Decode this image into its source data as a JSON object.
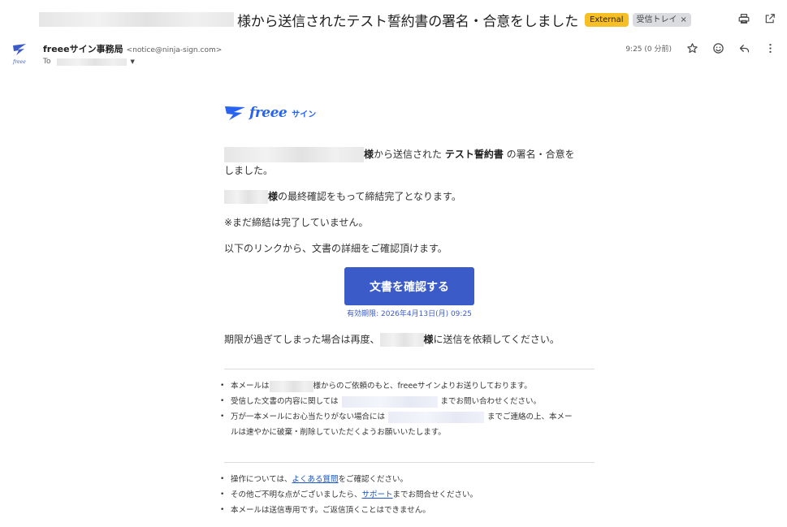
{
  "subject": {
    "text": "様から送信されたテスト誓約書の署名・合意をしました",
    "chips": {
      "external": "External",
      "inbox": "受信トレイ",
      "inbox_close": "×"
    }
  },
  "top_icons": [
    "print-icon",
    "open-in-new-window-icon"
  ],
  "sender": {
    "name": "freeeサイン事務局",
    "email": "<notice@ninja-sign.com>",
    "to_label": "To",
    "time": "9:25 (0 分前)"
  },
  "email_body": {
    "logo": {
      "brand": "freee",
      "product": "サイン"
    },
    "para1": {
      "suffix_sama": "様",
      "text_a": "から送信された ",
      "doc_name": "テスト誓約書",
      "text_b": " の署名・合意を",
      "text_c": "しました。"
    },
    "para2": {
      "sama": "様",
      "text": "の最終確認をもって締結完了となります。"
    },
    "para3": "※まだ締結は完了していません。",
    "para4": "以下のリンクから、文書の詳細をご確認頂けます。",
    "cta_button": "文書を確認する",
    "expiry": "有効期限: 2026年4月13日(月) 09:25",
    "para5": {
      "text_a": "期限が過ぎてしまった場合は再度、",
      "sama": "様",
      "text_b": "に送信を依頼してください。"
    },
    "notes1": [
      {
        "a": "本メールは",
        "b": "様からのご依頼のもと、freeeサインよりお送りしております。"
      },
      {
        "a": "受信した文書の内容に関しては",
        "b": "までお問い合わせください。"
      },
      {
        "a": "万が一本メールにお心当たりがない場合には",
        "b": "までご連絡の上、本メー",
        "c": "ルは速やかに破棄・削除していただくようお願いいたします。"
      }
    ],
    "notes2": [
      {
        "a": "操作については、",
        "link": "よくある質問",
        "b": "をご確認ください。"
      },
      {
        "a": "その他ご不明な点がございましたら、",
        "link": "サポート",
        "b": "までお問合せください。"
      },
      {
        "a": "本メールは送信専用です。ご返信頂くことはできません。"
      }
    ]
  },
  "colors": {
    "accent": "#3b5bc8",
    "brand": "#2864f0",
    "external_chip": "#f6bf26",
    "link": "#1a56c9"
  }
}
